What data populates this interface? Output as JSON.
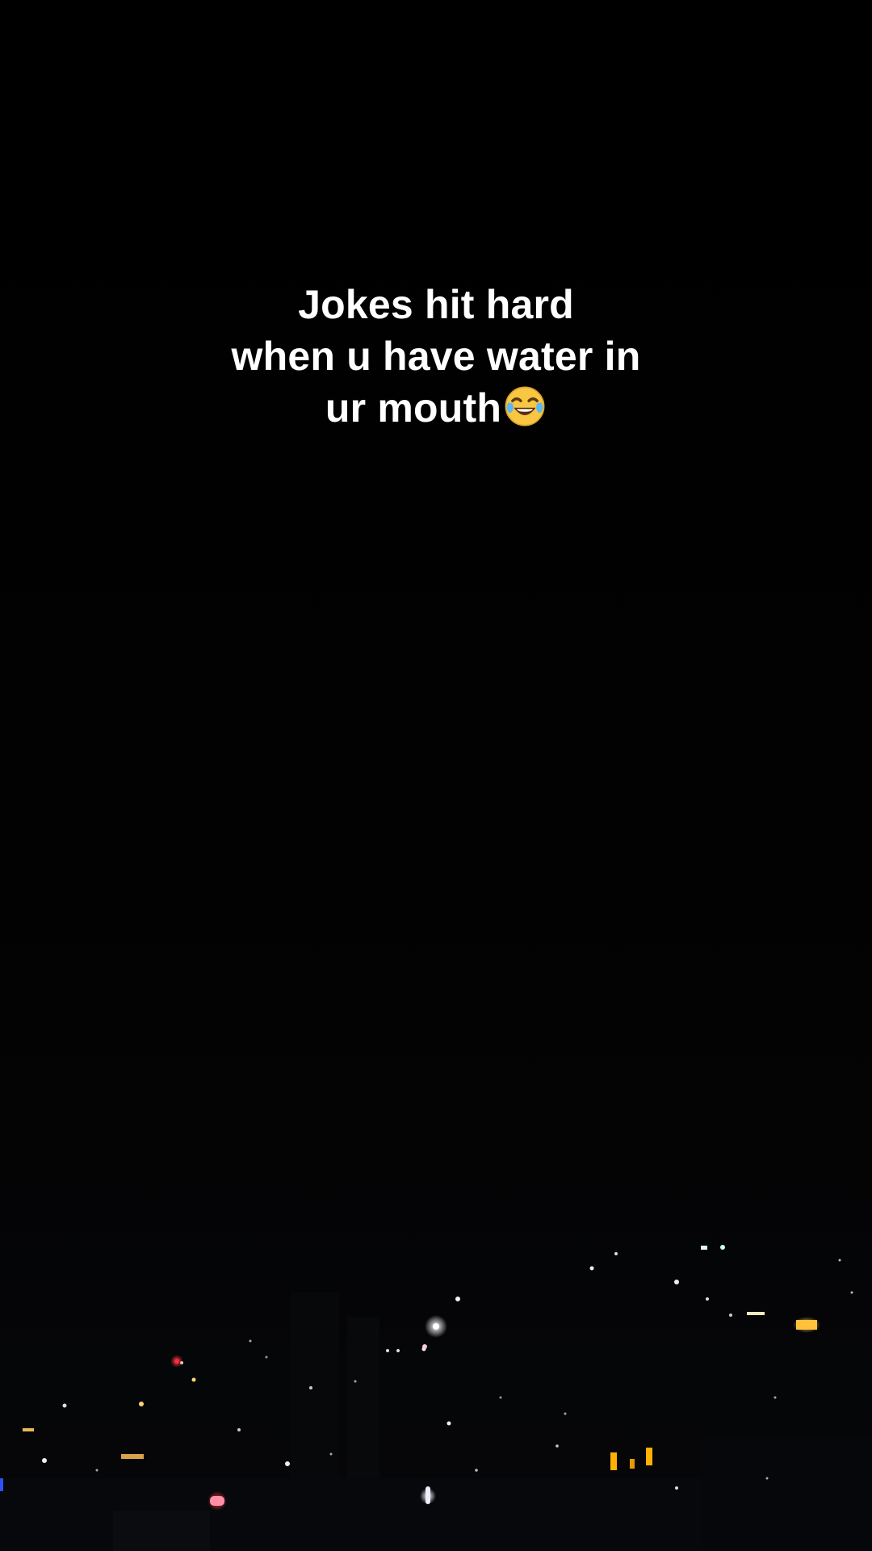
{
  "caption": {
    "line1": "Jokes hit hard",
    "line2": "when u have water in",
    "line3": "ur mouth",
    "emoji": "tears-of-joy-emoji"
  },
  "scene": {
    "background": "night city skyline",
    "background_color": "#000000",
    "light_colors": [
      "#ffffff",
      "#ffd27a",
      "#ff2a3a",
      "#ffb000"
    ]
  }
}
